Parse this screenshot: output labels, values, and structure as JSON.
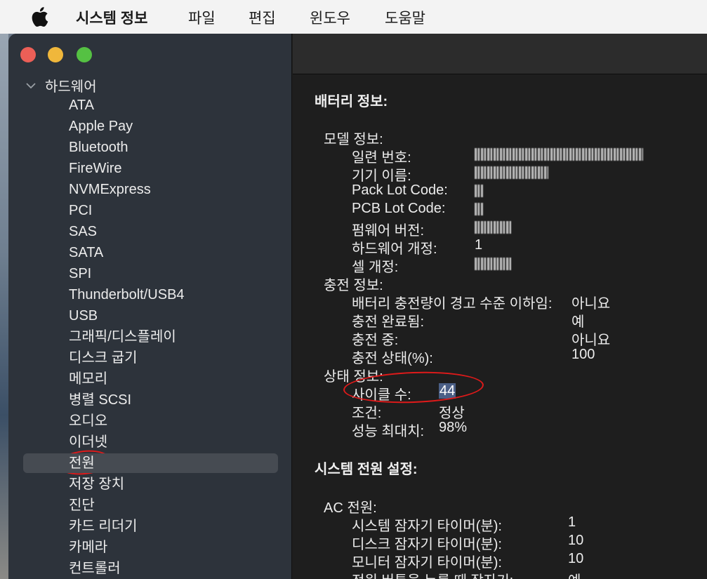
{
  "menubar": {
    "app_title": "시스템 정보",
    "items": [
      "파일",
      "편집",
      "윈도우",
      "도움말"
    ]
  },
  "sidebar": {
    "root_label": "하드웨어",
    "items": [
      {
        "label": "ATA"
      },
      {
        "label": "Apple Pay"
      },
      {
        "label": "Bluetooth"
      },
      {
        "label": "FireWire"
      },
      {
        "label": "NVMExpress"
      },
      {
        "label": "PCI"
      },
      {
        "label": "SAS"
      },
      {
        "label": "SATA"
      },
      {
        "label": "SPI"
      },
      {
        "label": "Thunderbolt/USB4"
      },
      {
        "label": "USB"
      },
      {
        "label": "그래픽/디스플레이"
      },
      {
        "label": "디스크 굽기"
      },
      {
        "label": "메모리"
      },
      {
        "label": "병렬 SCSI"
      },
      {
        "label": "오디오"
      },
      {
        "label": "이더넷"
      },
      {
        "label": "전원",
        "selected": true
      },
      {
        "label": "저장 장치"
      },
      {
        "label": "진단"
      },
      {
        "label": "카드 리더기"
      },
      {
        "label": "카메라"
      },
      {
        "label": "컨트롤러"
      }
    ]
  },
  "content": {
    "battery_title": "배터리 정보:",
    "model_info": {
      "label": "모델 정보:",
      "serial_label": "일련 번호:",
      "device_name_label": "기기 이름:",
      "pack_lot_label": "Pack Lot Code:",
      "pcb_lot_label": "PCB Lot Code:",
      "firmware_label": "펌웨어 버전:",
      "hardware_rev_label": "하드웨어 개정:",
      "hardware_rev_value": "1",
      "cell_rev_label": "셀 개정:"
    },
    "charge_info": {
      "label": "충전 정보:",
      "low_warning_label": "배터리 충전량이 경고 수준 이하임:",
      "low_warning_value": "아니요",
      "fully_charged_label": "충전 완료됨:",
      "fully_charged_value": "예",
      "charging_label": "충전 중:",
      "charging_value": "아니요",
      "state_label": "충전 상태(%):",
      "state_value": "100"
    },
    "health_info": {
      "label": "상태 정보:",
      "cycle_label": "사이클 수:",
      "cycle_value": "44",
      "condition_label": "조건:",
      "condition_value": "정상",
      "max_capacity_label": "성능 최대치:",
      "max_capacity_value": "98%"
    },
    "power_settings_title": "시스템 전원 설정:",
    "ac_power": {
      "label": "AC 전원:",
      "sleep_label": "시스템 잠자기 타이머(분):",
      "sleep_value": "1",
      "disk_sleep_label": "디스크 잠자기 타이머(분):",
      "disk_sleep_value": "10",
      "display_sleep_label": "모니터 잠자기 타이머(분):",
      "display_sleep_value": "10",
      "power_button_label": "전원 버튼을 누를 때 잠자기:",
      "power_button_value": "예"
    }
  },
  "colors": {
    "annotation": "#e01a1a",
    "selection_bg": "#464b52",
    "highlight": "#4b5f86"
  }
}
